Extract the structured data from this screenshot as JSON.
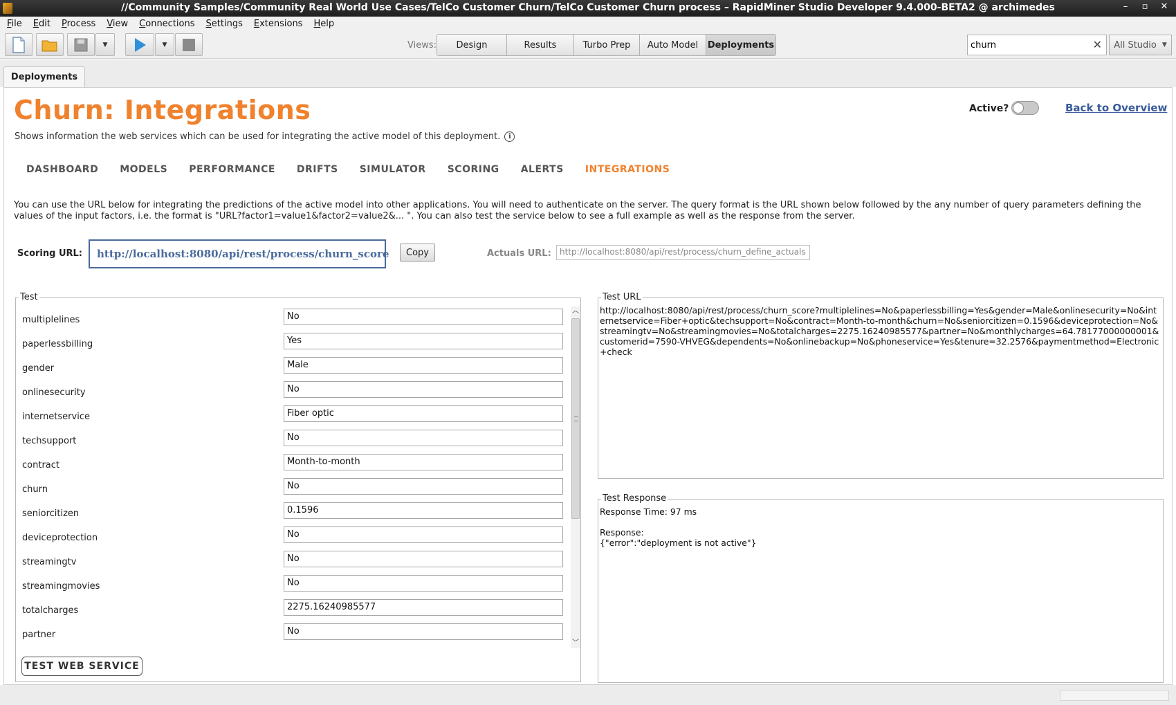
{
  "window": {
    "title": "//Community Samples/Community Real World Use Cases/TelCo Customer Churn/TelCo Customer Churn process – RapidMiner Studio Developer 9.4.000-BETA2 @ archimedes",
    "controls": [
      "–",
      "▫",
      "✕"
    ]
  },
  "menu": [
    "File",
    "Edit",
    "Process",
    "View",
    "Connections",
    "Settings",
    "Extensions",
    "Help"
  ],
  "toolbar": {
    "views_label": "Views:",
    "views": [
      "Design",
      "Results",
      "Turbo Prep",
      "Auto Model",
      "Deployments"
    ],
    "active_view": "Deployments",
    "search_value": "churn",
    "search_scope": "All Studio"
  },
  "doc_tab": "Deployments",
  "header": {
    "title": "Churn: Integrations",
    "subtitle": "Shows information the web services which can be used for integrating the active model of this deployment.",
    "active_label": "Active?",
    "active": false,
    "back_link": "Back to Overview"
  },
  "nav_tabs": [
    "DASHBOARD",
    "MODELS",
    "PERFORMANCE",
    "DRIFTS",
    "SIMULATOR",
    "SCORING",
    "ALERTS",
    "INTEGRATIONS"
  ],
  "active_nav": "INTEGRATIONS",
  "description": "You can use the URL below for integrating the predictions of the active model into other applications. You will need to authenticate on the server. The query format is the URL shown below followed by the any number of query parameters defining the values of the input factors, i.e. the format is \"URL?factor1=value1&factor2=value2&... \". You can also test the service below to see a full example as well as the response from the server.",
  "scoring": {
    "label": "Scoring URL:",
    "url": "http://localhost:8080/api/rest/process/churn_score",
    "copy_label": "Copy",
    "actuals_label": "Actuals URL:",
    "actuals_url": "http://localhost:8080/api/rest/process/churn_define_actuals"
  },
  "test": {
    "legend": "Test",
    "fields": [
      {
        "name": "multiplelines",
        "value": "No"
      },
      {
        "name": "paperlessbilling",
        "value": "Yes"
      },
      {
        "name": "gender",
        "value": "Male"
      },
      {
        "name": "onlinesecurity",
        "value": "No"
      },
      {
        "name": "internetservice",
        "value": "Fiber optic"
      },
      {
        "name": "techsupport",
        "value": "No"
      },
      {
        "name": "contract",
        "value": "Month-to-month"
      },
      {
        "name": "churn",
        "value": "No"
      },
      {
        "name": "seniorcitizen",
        "value": "0.1596"
      },
      {
        "name": "deviceprotection",
        "value": "No"
      },
      {
        "name": "streamingtv",
        "value": "No"
      },
      {
        "name": "streamingmovies",
        "value": "No"
      },
      {
        "name": "totalcharges",
        "value": "2275.16240985577"
      },
      {
        "name": "partner",
        "value": "No"
      }
    ],
    "button": "TEST WEB SERVICE"
  },
  "test_url": {
    "legend": "Test URL",
    "text": "http://localhost:8080/api/rest/process/churn_score?multiplelines=No&paperlessbilling=Yes&gender=Male&onlinesecurity=No&internetservice=Fiber+optic&techsupport=No&contract=Month-to-month&churn=No&seniorcitizen=0.1596&deviceprotection=No&streamingtv=No&streamingmovies=No&totalcharges=2275.16240985577&partner=No&monthlycharges=64.78177000000001&customerid=7590-VHVEG&dependents=No&onlinebackup=No&phoneservice=Yes&tenure=32.2576&paymentmethod=Electronic+check"
  },
  "test_response": {
    "legend": "Test Response",
    "text": "Response Time: 97 ms\n\nResponse:\n{\"error\":\"deployment is not active\"}"
  }
}
